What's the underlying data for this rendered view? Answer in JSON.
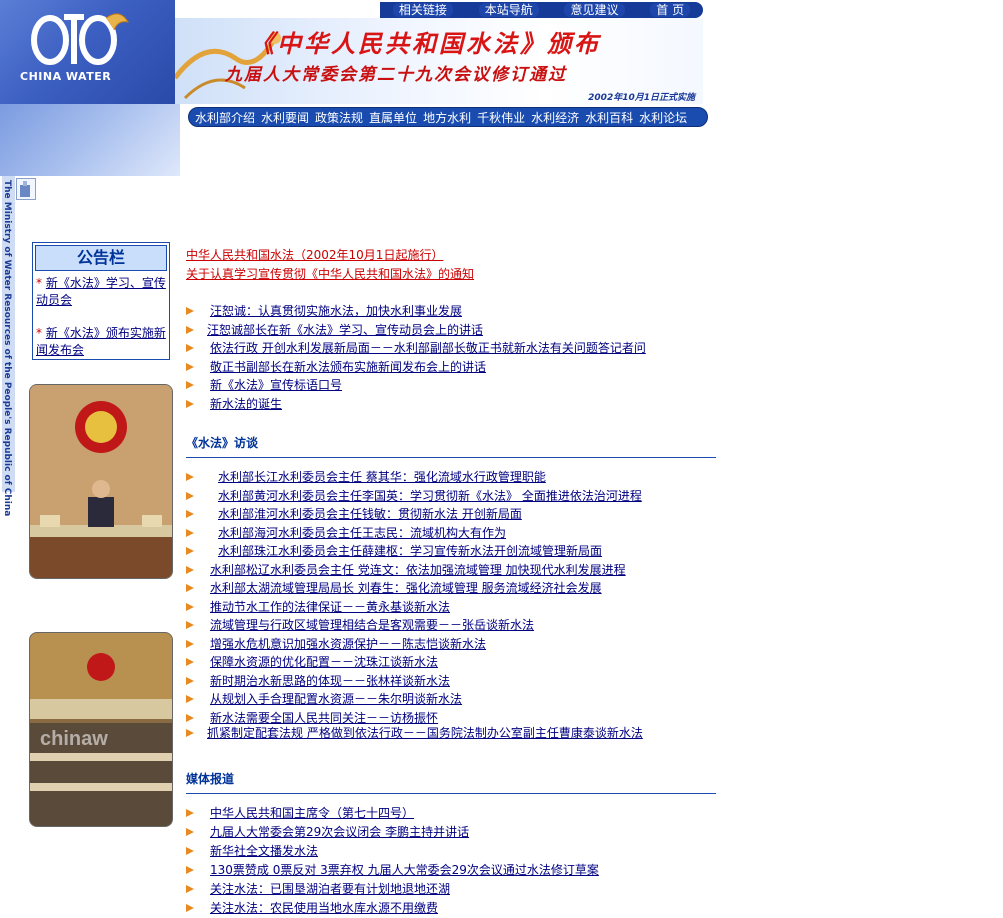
{
  "top_nav": [
    "相关链接",
    "本站导航",
    "意见建议",
    "首 页"
  ],
  "logo": {
    "text": "CHINA WATER"
  },
  "banner": {
    "title": "《中华人民共和国水法》颁布",
    "subtitle": "九届人大常委会第二十九次会议修订通过",
    "date": "2002年10月1日正式实施"
  },
  "main_nav": [
    "水利部介绍",
    "水利要闻",
    "政策法规",
    "直属单位",
    "地方水利",
    "千秋伟业",
    "水利经济",
    "水利百科",
    "水利论坛"
  ],
  "side_vertical": "The Ministry of Water Resources of the People's Republic of China",
  "bulletin": {
    "title": "公告栏",
    "items": [
      {
        "star": "*",
        "text": "新《水法》学习、宣传动员会"
      },
      {
        "star": "*",
        "text": "新《水法》颁布实施新闻发布会"
      }
    ]
  },
  "photo2_watermark": "chinaw",
  "top_links": [
    "中华人民共和国水法（2002年10月1日起施行）",
    "关于认真学习宣传贯彻《中华人民共和国水法》的通知"
  ],
  "list1": [
    "汪恕诚：认真贯彻实施水法，加快水利事业发展",
    "汪恕诚部长在新《水法》学习、宣传动员会上的讲话",
    "依法行政 开创水利发展新局面－－水利部副部长敬正书就新水法有关问题答记者问",
    "敬正书副部长在新水法颁布实施新闻发布会上的讲话",
    "新《水法》宣传标语口号",
    "新水法的诞生"
  ],
  "section_interview": "《水法》访谈",
  "list2": [
    "水利部长江水利委员会主任 蔡其华：强化流域水行政管理职能",
    "水利部黄河水利委员会主任李国英：学习贯彻新《水法》 全面推进依法治河进程",
    "水利部淮河水利委员会主任钱敏：贯彻新水法 开创新局面",
    "水利部海河水利委员会主任王志民：流域机构大有作为",
    "水利部珠江水利委员会主任薛建枢：学习宣传新水法开创流域管理新局面",
    "水利部松辽水利委员会主任 党连文：依法加强流域管理 加快现代水利发展进程",
    "水利部太湖流域管理局局长 刘春生：强化流域管理 服务流域经济社会发展",
    "推动节水工作的法律保证－－黄永基谈新水法",
    "流域管理与行政区域管理相结合是客观需要－－张岳谈新水法",
    "增强水危机意识加强水资源保护－－陈志恺谈新水法",
    "保障水资源的优化配置－－沈珠江谈新水法",
    "新时期治水新思路的体现－－张林祥谈新水法",
    "从规划入手合理配置水资源－－朱尔明谈新水法",
    "新水法需要全国人民共同关注－－访杨振怀",
    "抓紧制定配套法规 严格做到依法行政－－国务院法制办公室副主任曹康泰谈新水法"
  ],
  "section_media": "媒体报道",
  "list3": [
    "中华人民共和国主席令（第七十四号）",
    "九届人大常委会第29次会议闭会 李鹏主持并讲话",
    "新华社全文播发水法",
    "130票赞成 0票反对 3票弃权 九届人大常委会29次会议通过水法修订草案",
    "关注水法：已围垦湖泊者要有计划地退地还湖",
    "关注水法：农民使用当地水库水源不用缴费"
  ]
}
